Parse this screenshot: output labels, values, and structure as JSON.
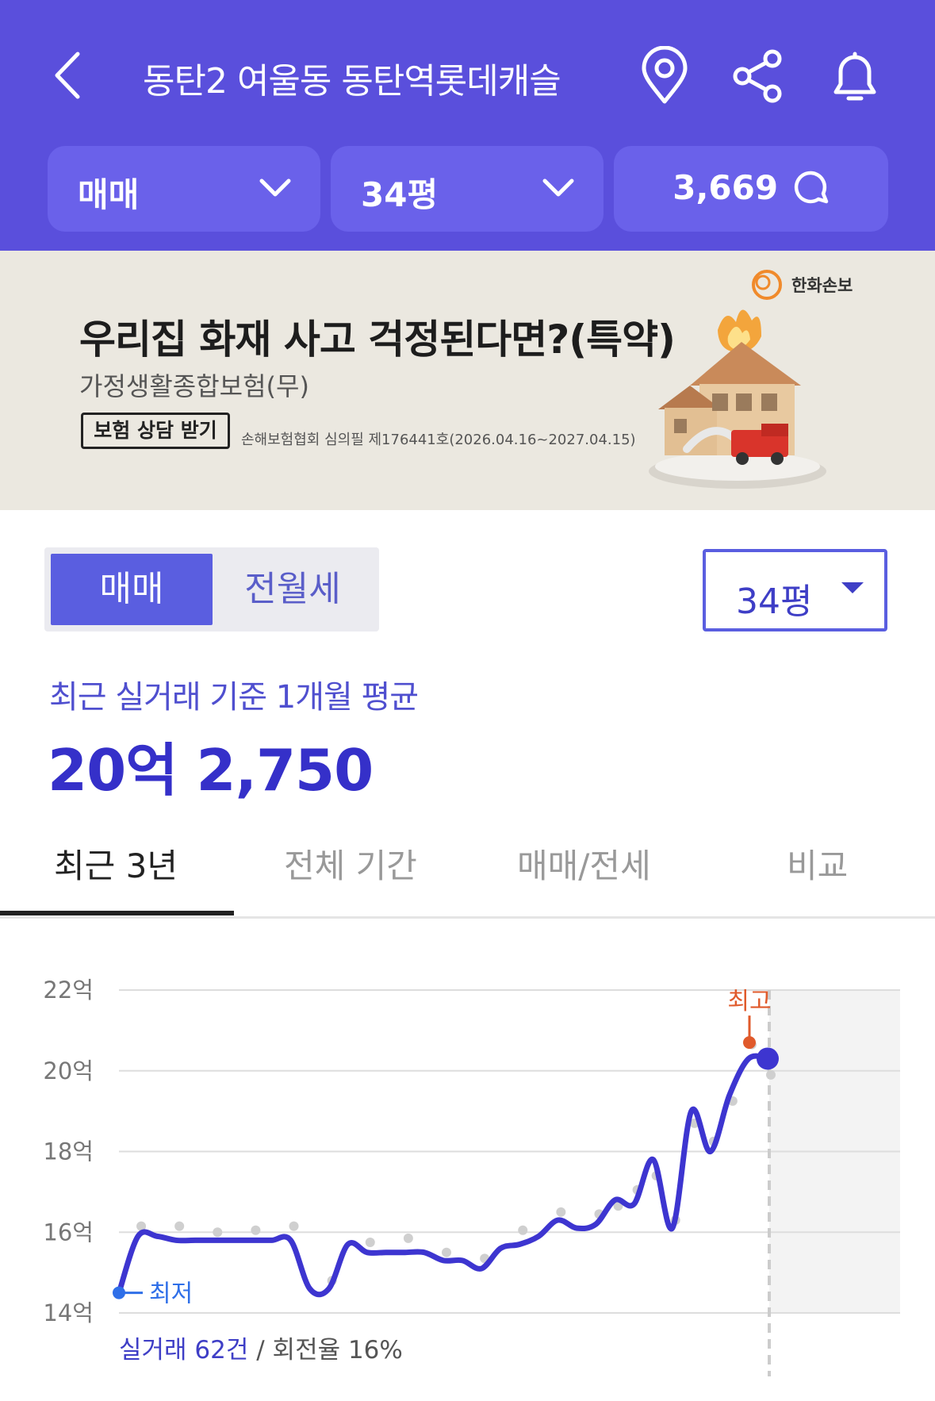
{
  "header": {
    "title": "동탄2 여울동 동탄역롯데캐슬",
    "icons": [
      "back-icon",
      "location-pin-icon",
      "share-icon",
      "bell-icon"
    ],
    "accent_color": "#5a4fdc"
  },
  "filters": {
    "deal_type": "매매",
    "size": "34평",
    "comment_count": "3,669"
  },
  "ad": {
    "brand": "한화손보",
    "title": "우리집 화재 사고 걱정된다면?(특약)",
    "subtitle": "가정생활종합보험(무)",
    "button": "보험 상담 받기",
    "note": "손해보험협회 심의필 제176441호(2026.04.16~2027.04.15)"
  },
  "segment": {
    "active": "매매",
    "inactive": "전월세"
  },
  "size_dropdown": "34평",
  "summary": {
    "label": "최근 실거래 기준 1개월 평균",
    "price": "20억 2,750"
  },
  "tabs": [
    "최근 3년",
    "전체 기간",
    "매매/전세",
    "비교"
  ],
  "chart_data": {
    "type": "line",
    "y_ticks": [
      "22억",
      "20억",
      "18억",
      "16억",
      "14억"
    ],
    "ylim": [
      14,
      22
    ],
    "y_unit": "억",
    "grid": true,
    "line_color": "#3d35d0",
    "min_label": "최저",
    "max_label": "최고",
    "min_color": "#2f6fe8",
    "max_color": "#e05a2b",
    "series": [
      {
        "values": [
          14.5,
          15.9,
          15.9,
          15.8,
          15.8,
          15.8,
          15.8,
          15.8,
          15.8,
          15.8,
          14.6,
          14.6,
          15.7,
          15.5,
          15.5,
          15.5,
          15.5,
          15.3,
          15.3,
          15.1,
          15.6,
          15.7,
          15.9,
          16.3,
          16.1,
          16.2,
          16.8,
          16.7,
          17.8,
          16.1,
          19.0,
          18.0,
          19.4,
          20.3,
          20.3
        ]
      }
    ],
    "footer_prefix": "실거래 62건",
    "footer_suffix": "/ 회전율 16%"
  }
}
